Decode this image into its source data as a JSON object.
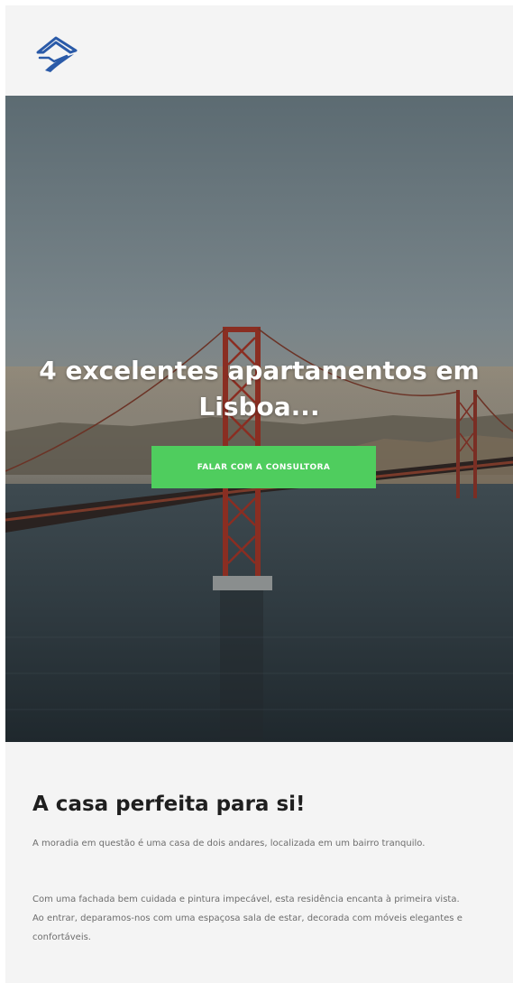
{
  "header": {
    "logo_icon": "house-roof-swoosh-logo"
  },
  "hero": {
    "title": "4 excelentes apartamentos em Lisboa...",
    "cta_label": "FALAR COM A CONSULTORA",
    "cta_color": "#4fcd5e"
  },
  "content": {
    "title": "A casa perfeita para si!",
    "paragraph_1": "A moradia em questão é uma casa de dois andares, localizada em um bairro tranquilo.",
    "paragraph_2_line_1": "Com uma fachada bem cuidada e pintura impecável, esta residência encanta à primeira vista.",
    "paragraph_2_line_2": "Ao entrar, deparamos-nos com uma espaçosa sala de estar, decorada com móveis elegantes e confortáveis."
  },
  "colors": {
    "page_background": "#f4f4f4",
    "logo_blue": "#2a5aa8"
  }
}
